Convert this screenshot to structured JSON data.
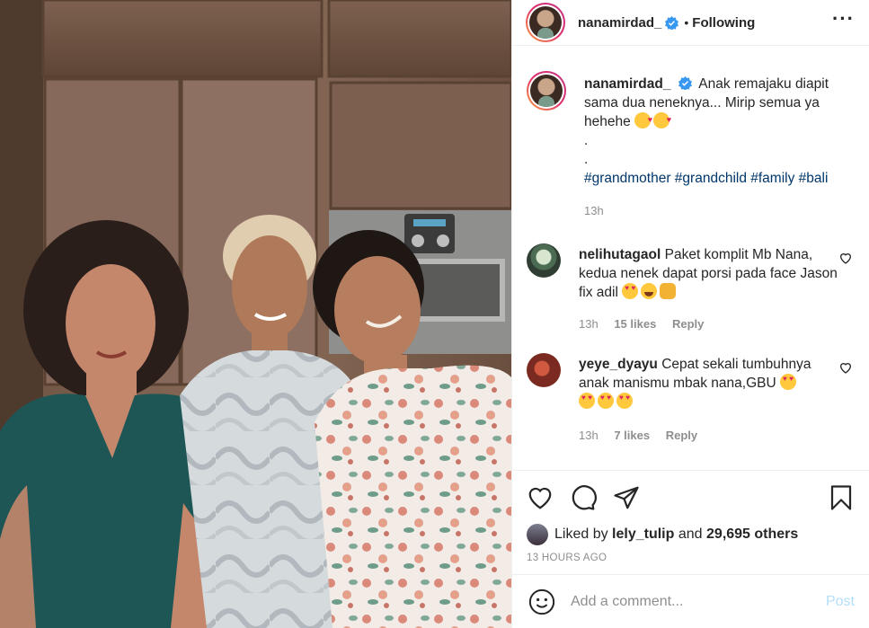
{
  "header": {
    "username": "nanamirdad_",
    "verified": true,
    "separator": "•",
    "follow_state": "Following",
    "more_icon": "more-dots-icon"
  },
  "caption": {
    "username": "nanamirdad_",
    "text_line": "Anak remajaku diapit sama dua neneknya... Mirip semua ya hehehe",
    "dot1": ".",
    "dot2": ".",
    "hashtags": "#grandmother #grandchild #family #bali",
    "time": "13h"
  },
  "comments": [
    {
      "username": "nelihutagaol",
      "text": "Paket komplit Mb Nana, kedua nenek dapat porsi pada face Jason fix adil",
      "time": "13h",
      "likes": "15 likes",
      "reply": "Reply"
    },
    {
      "username": "yeye_dyayu",
      "text": "Cepat sekali tumbuhnya anak manismu mbak nana,GBU",
      "time": "13h",
      "likes": "7 likes",
      "reply": "Reply"
    }
  ],
  "likes": {
    "prefix": "Liked by",
    "user": "lely_tulip",
    "and": "and",
    "others": "29,695 others"
  },
  "timestamp": "13 HOURS AGO",
  "comment_input": {
    "placeholder": "Add a comment...",
    "post_label": "Post"
  },
  "colors": {
    "link": "#00376b",
    "muted": "#8e8e8e",
    "post_disabled": "#b2dffc",
    "verified": "#3897f0"
  }
}
